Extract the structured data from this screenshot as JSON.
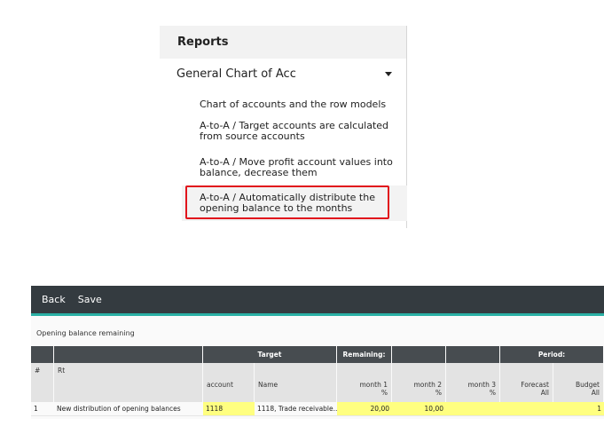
{
  "reports": {
    "title": "Reports",
    "section": "General Chart of Acc",
    "items": [
      "Chart of accounts and the row models",
      "A-to-A / Target accounts are calculated from source accounts",
      "A-to-A / Move profit account values into balance, decrease them",
      "A-to-A / Automatically distribute the opening balance to the months"
    ],
    "highlight_color": "#e1141c"
  },
  "form": {
    "toolbar": {
      "back": "Back",
      "save": "Save",
      "accent": "#2ab0a5",
      "bg": "#343b40"
    },
    "title": "Opening balance remaining",
    "groups": {
      "target": "Target",
      "remaining": "Remaining:",
      "period": "Period:"
    },
    "columns": {
      "num": "#",
      "rt": "Rt",
      "account": "account",
      "name": "Name",
      "m1_a": "month 1",
      "m1_b": "%",
      "m2_a": "month 2",
      "m2_b": "%",
      "m3_a": "month 3",
      "m3_b": "%",
      "fc_a": "Forecast",
      "fc_b": "All",
      "bu_a": "Budget",
      "bu_b": "All"
    },
    "rows": [
      {
        "num": "1",
        "rt": "New distribution of opening balances",
        "account": "1118",
        "name": "1118, Trade receivable...",
        "m1": "20,00",
        "m2": "10,00",
        "m3": "",
        "forecast": "",
        "budget": "1"
      }
    ]
  }
}
